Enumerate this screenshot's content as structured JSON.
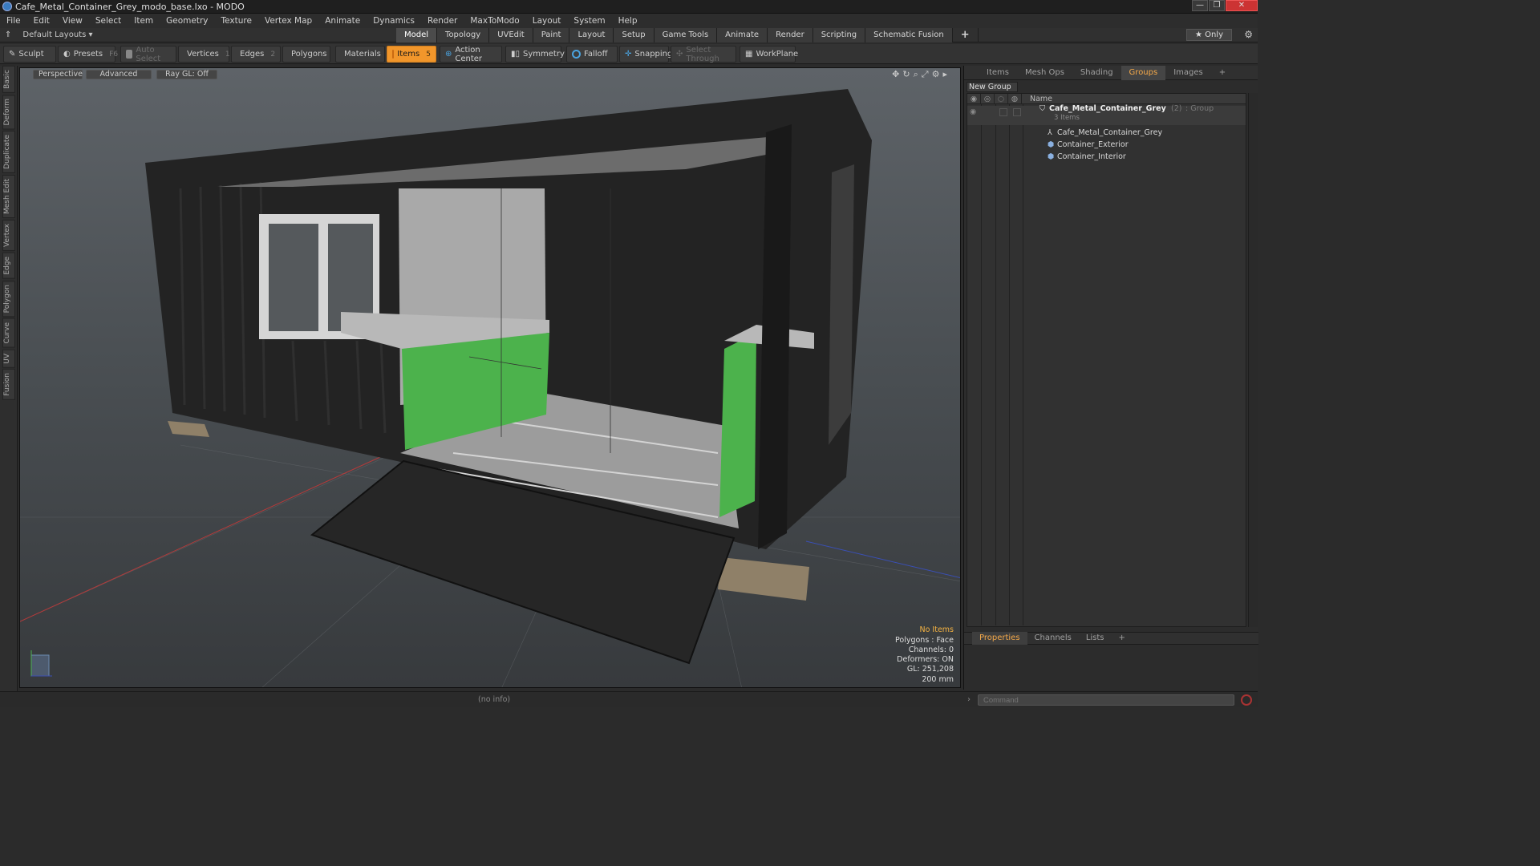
{
  "window": {
    "title": "Cafe_Metal_Container_Grey_modo_base.lxo - MODO",
    "min": "—",
    "max": "❐",
    "close": "✕"
  },
  "menu": [
    "File",
    "Edit",
    "View",
    "Select",
    "Item",
    "Geometry",
    "Texture",
    "Vertex Map",
    "Animate",
    "Dynamics",
    "Render",
    "MaxToModo",
    "Layout",
    "System",
    "Help"
  ],
  "layoutbar": {
    "layouts_label": "Default Layouts ▾",
    "tabs": [
      "Model",
      "Topology",
      "UVEdit",
      "Paint",
      "Layout",
      "Setup",
      "Game Tools",
      "Animate",
      "Render",
      "Scripting",
      "Schematic Fusion"
    ],
    "active_tab": "Model",
    "plus": "+",
    "only": "★  Only",
    "gear": "⚙"
  },
  "toolbar": {
    "sculpt": "Sculpt",
    "presets": "Presets",
    "presets_key": "F6",
    "auto_select": "Auto Select",
    "vertices": "Vertices",
    "vertices_key": "1",
    "edges": "Edges",
    "edges_key": "2",
    "polygons": "Polygons",
    "materials": "Materials",
    "items": "Items",
    "items_key": "5",
    "action_center": "Action Center",
    "symmetry": "Symmetry",
    "falloff": "Falloff",
    "snapping": "Snapping",
    "select_through": "Select Through",
    "workplane": "WorkPlane"
  },
  "sidetabs": [
    "Basic",
    "Deform",
    "Duplicate",
    "Mesh Edit",
    "Vertex",
    "Edge",
    "Polygon",
    "Curve",
    "UV",
    "Fusion"
  ],
  "viewport": {
    "view_mode": "Perspective",
    "shading": "Advanced",
    "raygl": "Ray GL: Off",
    "hud": {
      "selection": "No Items",
      "polygons": "Polygons : Face",
      "channels": "Channels: 0",
      "deformers": "Deformers: ON",
      "gl": "GL: 251,208",
      "grid": "200 mm"
    }
  },
  "right_panel": {
    "tabs": [
      "Items",
      "Mesh Ops",
      "Shading",
      "Groups",
      "Images"
    ],
    "active_tab": "Groups",
    "plus": "+",
    "new_group": "New Group",
    "name_header": "Name",
    "group": {
      "name": "Cafe_Metal_Container_Grey",
      "count": "(2)",
      "type": ": Group",
      "sub": "3 Items"
    },
    "children": [
      "Cafe_Metal_Container_Grey",
      "Container_Exterior",
      "Container_Interior"
    ],
    "bottom_tabs": [
      "Properties",
      "Channels",
      "Lists"
    ],
    "bottom_active": "Properties"
  },
  "status": {
    "info": "(no info)",
    "command_placeholder": "Command"
  }
}
